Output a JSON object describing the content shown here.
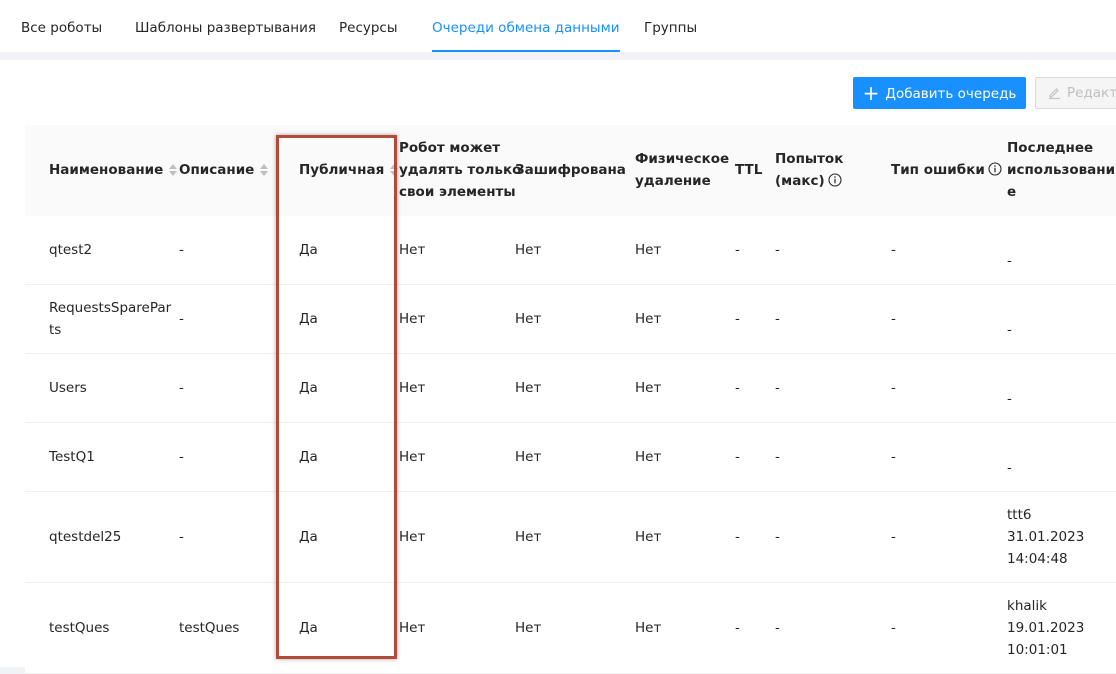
{
  "tabs": [
    {
      "label": "Все роботы",
      "active": false
    },
    {
      "label": "Шаблоны развертывания",
      "active": false
    },
    {
      "label": "Ресурсы",
      "active": false
    },
    {
      "label": "Очереди обмена данными",
      "active": true
    },
    {
      "label": "Группы",
      "active": false
    }
  ],
  "toolbar": {
    "add_label": "Добавить очередь",
    "edit_label": "Редакт"
  },
  "columns": {
    "name": "Наименование",
    "description": "Описание",
    "public": "Публичная",
    "robot_delete_own": [
      "Робот может",
      "удалять только",
      "свои элементы"
    ],
    "encrypted": "Зашифрована",
    "physical_delete": [
      "Физическое",
      "удаление"
    ],
    "ttl": "TTL",
    "attempts": [
      "Попыток",
      "(макс)"
    ],
    "error_type": "Тип ошибки",
    "last_used": [
      "Последнее",
      "использовани",
      "е"
    ]
  },
  "rows": [
    {
      "name": [
        "qtest2"
      ],
      "description": "-",
      "public": "Да",
      "robot_delete_own": "Нет",
      "encrypted": "Нет",
      "physical_delete": "Нет",
      "ttl": "-",
      "attempts": "-",
      "error_type": "-",
      "last_used": [
        "-"
      ]
    },
    {
      "name": [
        "RequestsSparePar",
        "ts"
      ],
      "description": "-",
      "public": "Да",
      "robot_delete_own": "Нет",
      "encrypted": "Нет",
      "physical_delete": "Нет",
      "ttl": "-",
      "attempts": "-",
      "error_type": "-",
      "last_used": [
        "-"
      ]
    },
    {
      "name": [
        "Users"
      ],
      "description": "-",
      "public": "Да",
      "robot_delete_own": "Нет",
      "encrypted": "Нет",
      "physical_delete": "Нет",
      "ttl": "-",
      "attempts": "-",
      "error_type": "-",
      "last_used": [
        "-"
      ]
    },
    {
      "name": [
        "TestQ1"
      ],
      "description": "-",
      "public": "Да",
      "robot_delete_own": "Нет",
      "encrypted": "Нет",
      "physical_delete": "Нет",
      "ttl": "-",
      "attempts": "-",
      "error_type": "-",
      "last_used": [
        "-"
      ]
    },
    {
      "name": [
        "qtestdel25"
      ],
      "description": "-",
      "public": "Да",
      "robot_delete_own": "Нет",
      "encrypted": "Нет",
      "physical_delete": "Нет",
      "ttl": "-",
      "attempts": "-",
      "error_type": "-",
      "last_used": [
        "ttt6",
        "31.01.2023",
        "14:04:48"
      ]
    },
    {
      "name": [
        "testQues"
      ],
      "description": "testQues",
      "public": "Да",
      "robot_delete_own": "Нет",
      "encrypted": "Нет",
      "physical_delete": "Нет",
      "ttl": "-",
      "attempts": "-",
      "error_type": "-",
      "last_used": [
        "khalik",
        "19.01.2023",
        "10:01:01"
      ]
    }
  ],
  "colors": {
    "accent": "#1890ff",
    "highlight_border": "#b5493a"
  }
}
